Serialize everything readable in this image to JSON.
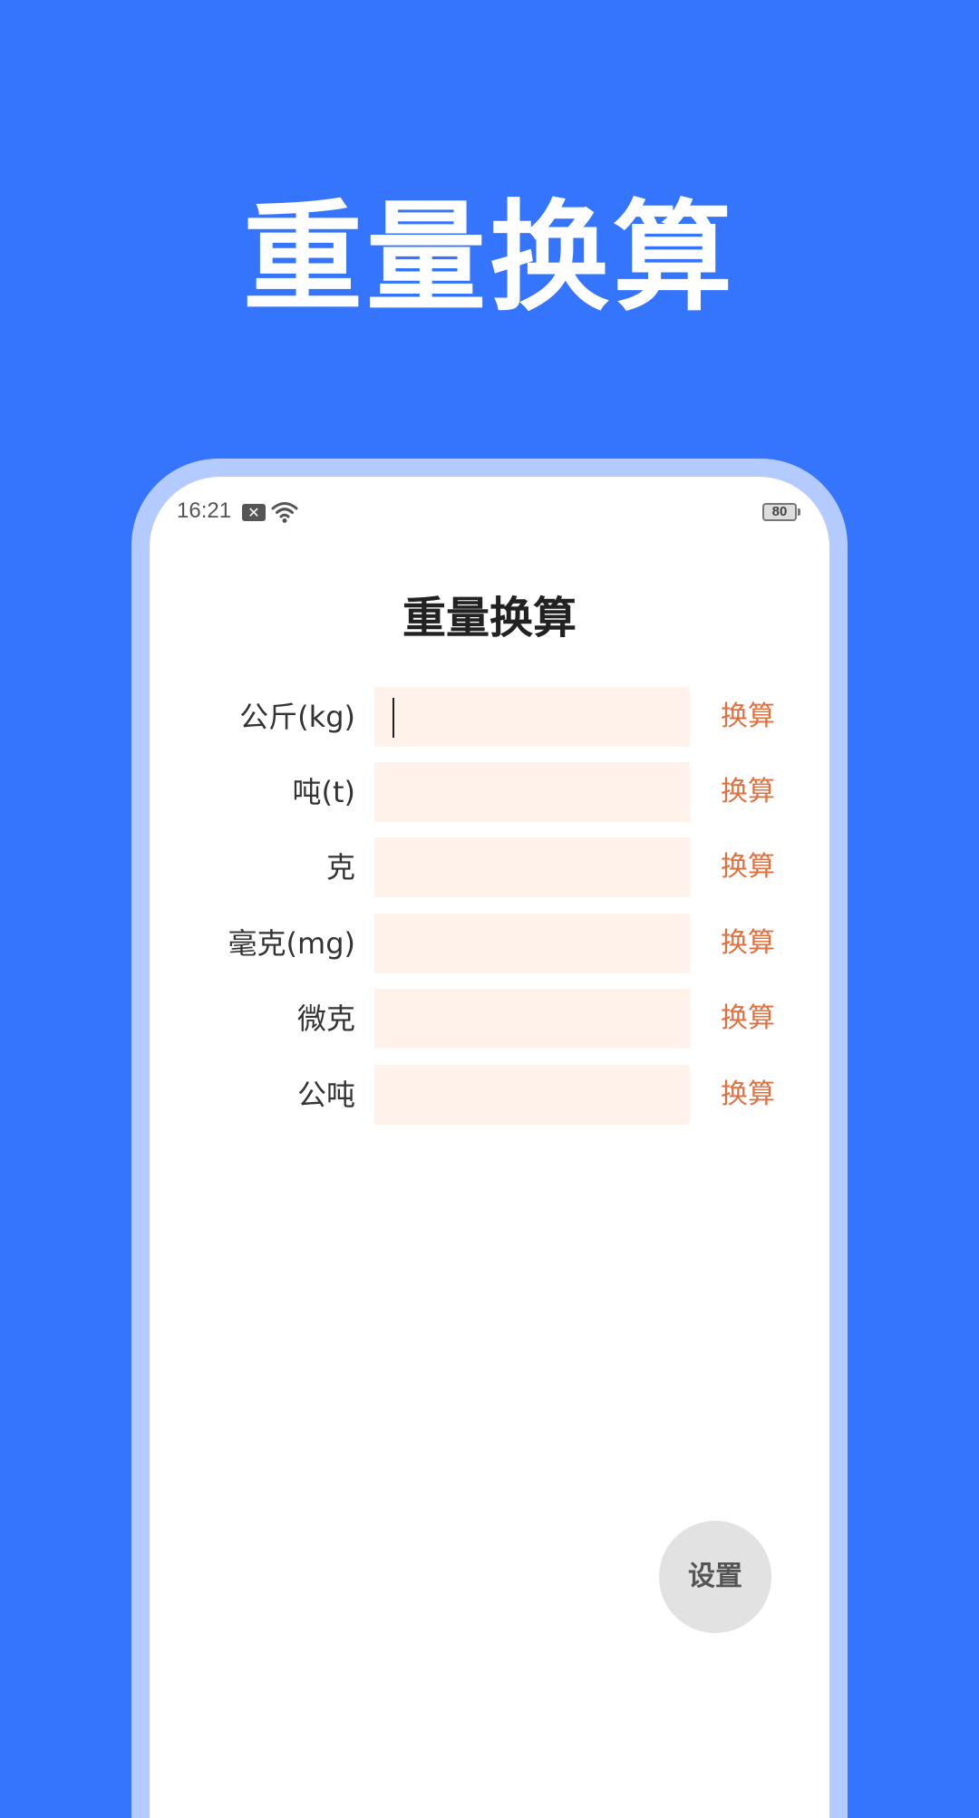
{
  "promo": {
    "title": "重量换算"
  },
  "status_bar": {
    "time": "16:21",
    "sim_icon": "sim-error-icon",
    "wifi_icon": "wifi-icon",
    "battery_level": "80"
  },
  "screen": {
    "title": "重量换算"
  },
  "converter": {
    "rows": [
      {
        "label": "公斤(kg)",
        "value": "",
        "button": "换算"
      },
      {
        "label": "吨(t)",
        "value": "",
        "button": "换算"
      },
      {
        "label": "克",
        "value": "",
        "button": "换算"
      },
      {
        "label": "毫克(mg)",
        "value": "",
        "button": "换算"
      },
      {
        "label": "微克",
        "value": "",
        "button": "换算"
      },
      {
        "label": "公吨",
        "value": "",
        "button": "换算"
      }
    ]
  },
  "fab": {
    "label": "设置"
  },
  "colors": {
    "background": "#3575FE",
    "bezel": "#B3CBFF",
    "input_bg": "#FFF2EA",
    "button_text": "#E0703E",
    "fab_bg": "#E2E2E2"
  }
}
